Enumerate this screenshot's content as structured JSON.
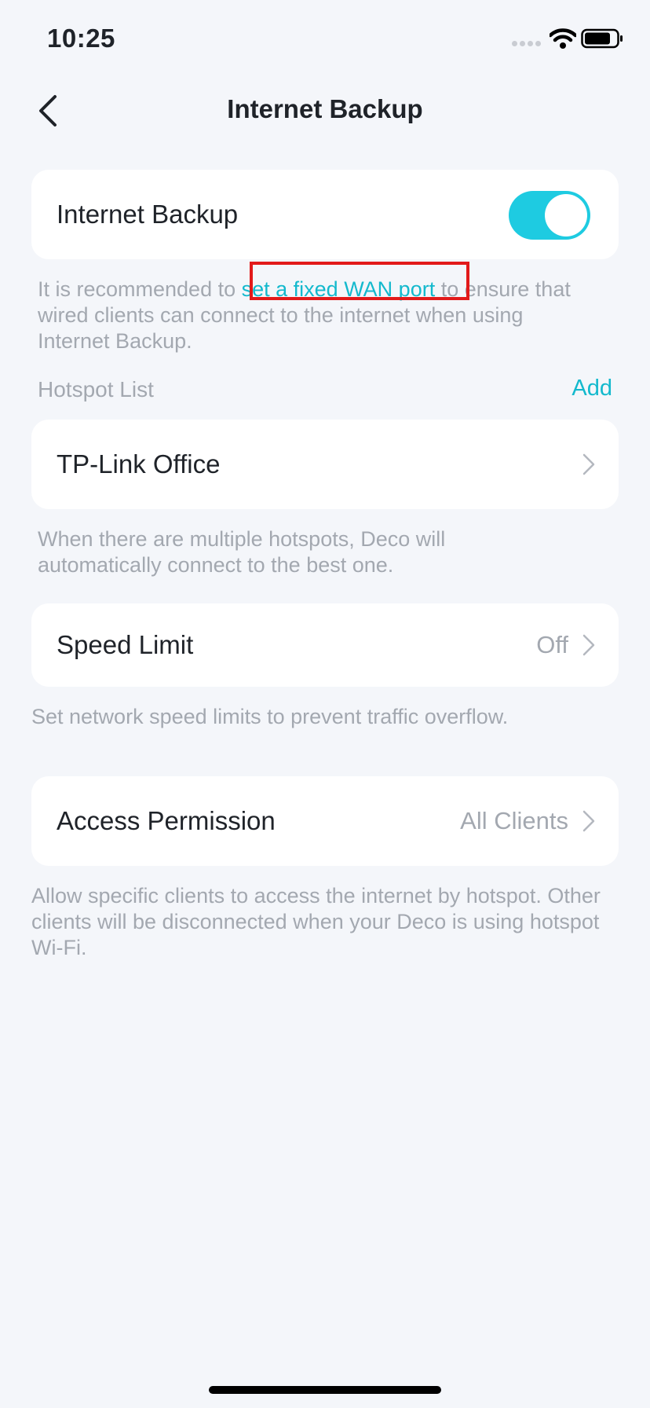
{
  "status_bar": {
    "time": "10:25"
  },
  "header": {
    "title": "Internet Backup"
  },
  "internet_backup": {
    "label": "Internet Backup",
    "enabled": true
  },
  "wan_note": {
    "prefix": "It is recommended to ",
    "link": "set a fixed WAN port",
    "suffix": " to ensure that wired clients can connect to the internet when using Internet Backup."
  },
  "hotspot_list": {
    "header": "Hotspot List",
    "add_label": "Add",
    "items": [
      {
        "name": "TP-Link Office"
      }
    ],
    "note": "When there are multiple hotspots, Deco will automatically connect to the best one."
  },
  "speed_limit": {
    "label": "Speed Limit",
    "value": "Off",
    "note": "Set network speed limits to prevent traffic overflow."
  },
  "access_permission": {
    "label": "Access Permission",
    "value": "All Clients",
    "note": "Allow specific clients to access the internet by hotspot. Other clients will be disconnected when your Deco is using hotspot Wi-Fi."
  },
  "colors": {
    "accent": "#1ecbe1",
    "link": "#13b9cd",
    "highlight_box": "#e21a1a",
    "background": "#f4f6fa"
  },
  "icons": [
    "back-arrow-icon",
    "chevron-right-icon",
    "wifi-icon",
    "battery-icon",
    "signal-icon"
  ]
}
